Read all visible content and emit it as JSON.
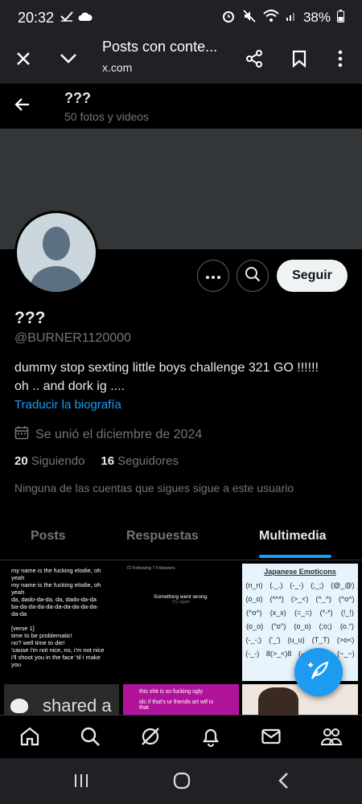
{
  "status_bar": {
    "time": "20:32",
    "battery": "38%"
  },
  "browser": {
    "page_title": "Posts con conte...",
    "host": "x.com"
  },
  "profile_bar": {
    "name": "???",
    "subtitle": "50 fotos y videos"
  },
  "profile": {
    "name": "???",
    "handle": "@BURNER1120000",
    "bio_line1": "dummy stop sexting little boys challenge 321 GO !!!!!!",
    "bio_line2": "oh .. and dork ig ....",
    "translate_label": "Traducir la biografía",
    "joined": "Se unió el diciembre de 2024",
    "following_count": "20",
    "following_label": "Siguiendo",
    "followers_count": "16",
    "followers_label": "Seguidores",
    "mutuals_note": "Ninguna de las cuentas que sigues sigue a este usuario",
    "follow_button": "Seguir"
  },
  "tabs": [
    {
      "label": "Posts",
      "active": false
    },
    {
      "label": "Respuestas",
      "active": false
    },
    {
      "label": "Multimedia",
      "active": true
    }
  ],
  "media": {
    "lyrics_lines": [
      "my name is the fucking elodie, oh",
      "yeah",
      "my name is the fucking elodie, oh",
      "yeah",
      "da, dado-da-da, da, dado-da-da",
      "ba-da-da-da-da-da-da-da-da-da-",
      "da-da",
      "",
      "[verse 1]",
      "time to be problematic!",
      "no? well time to die!",
      "'cause i'm not nice, no, i'm not nice",
      "i'll shoot you in the face 'til i make you"
    ],
    "tweet_card_meta": "72 Following  7 Followers",
    "tweet_card_text": "Something went wrong.",
    "tweet_card_sub": "Try again",
    "emoticon_title": "Japanese Emoticons",
    "emoticon_rows": [
      [
        "(n_n)",
        "(._.)",
        "(-_-)",
        "(;_;)",
        "(@_@)"
      ],
      [
        "(o_o)",
        "(*^*)",
        "(>_<)",
        "(^_^)",
        "(^o^)"
      ],
      [
        "(^o^)",
        "(x_x)",
        "(=_=)",
        "(*-*)",
        "(!_!)"
      ],
      [
        "(o_o)",
        "(°o°)",
        "(o_o)",
        "(;o;)",
        "(o.°)"
      ],
      [
        "(-_-;)",
        "('_')",
        "(u_u)",
        "(T_T)",
        "(>o<)"
      ],
      [
        "(-_-)",
        "8(>_<)8",
        "(-_-)",
        "(;-;)",
        "(~_~)"
      ]
    ],
    "bottom_left_text": "shared a",
    "bottom_mid_line1": "this shit is so fucking ugly",
    "bottom_mid_line2": "idc if that's ur friends art wtf is that"
  },
  "colors": {
    "accent": "#1d9bf0",
    "banner": "#333639",
    "muted": "#71767b"
  }
}
